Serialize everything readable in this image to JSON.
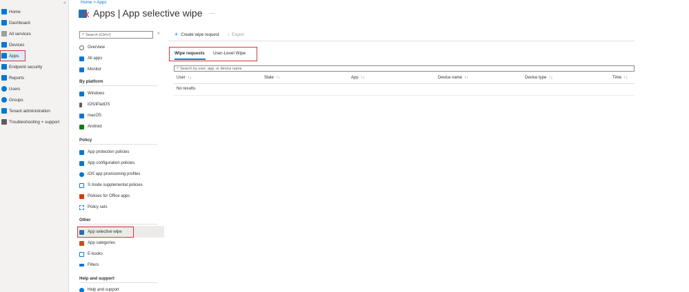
{
  "nav": {
    "collapse_glyph": "«",
    "items": [
      {
        "label": "Home",
        "icon": "home-icon",
        "color": "#0078d4"
      },
      {
        "label": "Dashboard",
        "icon": "dashboard-icon",
        "color": "#0078d4"
      },
      {
        "label": "All services",
        "icon": "list-icon",
        "color": "#605e5c"
      },
      {
        "label": "Devices",
        "icon": "devices-icon",
        "color": "#0078d4"
      },
      {
        "label": "Apps",
        "icon": "apps-icon",
        "color": "#0078d4"
      },
      {
        "label": "Endpoint security",
        "icon": "shield-icon",
        "color": "#0078d4"
      },
      {
        "label": "Reports",
        "icon": "reports-icon",
        "color": "#0078d4"
      },
      {
        "label": "Users",
        "icon": "user-icon",
        "color": "#0078d4"
      },
      {
        "label": "Groups",
        "icon": "groups-icon",
        "color": "#0078d4"
      },
      {
        "label": "Tenant administration",
        "icon": "tenant-icon",
        "color": "#0078d4"
      },
      {
        "label": "Troubleshooting + support",
        "icon": "wrench-icon",
        "color": "#605e5c"
      }
    ]
  },
  "breadcrumb": "Home  >  Apps",
  "page": {
    "title": "Apps | App selective wipe",
    "more": "···"
  },
  "menu": {
    "search_placeholder": "Search (Ctrl+/)",
    "collapse_glyph": "«",
    "top_items": [
      {
        "label": "Overview",
        "icon": "info-icon",
        "color": "#605e5c"
      },
      {
        "label": "All apps",
        "icon": "grid-icon",
        "color": "#0078d4"
      },
      {
        "label": "Monitor",
        "icon": "monitor-icon",
        "color": "#0078d4"
      }
    ],
    "sections": [
      {
        "heading": "By platform",
        "items": [
          {
            "label": "Windows",
            "icon": "windows-icon",
            "color": "#0078d4"
          },
          {
            "label": "iOS/iPadOS",
            "icon": "phone-icon",
            "color": "#605e5c"
          },
          {
            "label": "macOS",
            "icon": "mac-icon",
            "color": "#0078d4"
          },
          {
            "label": "Android",
            "icon": "android-icon",
            "color": "#107c10"
          }
        ]
      },
      {
        "heading": "Policy",
        "items": [
          {
            "label": "App protection policies",
            "icon": "protection-icon",
            "color": "#0078d4"
          },
          {
            "label": "App configuration policies",
            "icon": "config-icon",
            "color": "#0078d4"
          },
          {
            "label": "iOS app provisioning profiles",
            "icon": "provisioning-icon",
            "color": "#0078d4"
          },
          {
            "label": "S mode supplemental policies",
            "icon": "smode-icon",
            "color": "#0078d4"
          },
          {
            "label": "Policies for Office apps",
            "icon": "office-icon",
            "color": "#d83b01"
          },
          {
            "label": "Policy sets",
            "icon": "policy-sets-icon",
            "color": "#0078d4"
          }
        ]
      },
      {
        "heading": "Other",
        "items": [
          {
            "label": "App selective wipe",
            "icon": "wipe-icon",
            "color": "#2b6cb0"
          },
          {
            "label": "App categories",
            "icon": "categories-icon",
            "color": "#ca5010"
          },
          {
            "label": "E-books",
            "icon": "ebook-icon",
            "color": "#0078d4"
          },
          {
            "label": "Filters",
            "icon": "filter-icon",
            "color": "#0078d4"
          }
        ]
      },
      {
        "heading": "Help and support",
        "items": [
          {
            "label": "Help and support",
            "icon": "help-icon",
            "color": "#0078d4"
          }
        ]
      }
    ]
  },
  "toolbar": {
    "create_label": "Create wipe request",
    "export_label": "Export"
  },
  "tabs": [
    {
      "label": "Wipe requests",
      "active": true
    },
    {
      "label": "User-Level Wipe",
      "active": false
    }
  ],
  "grid": {
    "search_placeholder": "Search by user, app, or device name",
    "columns": [
      "User",
      "State",
      "App",
      "Device name",
      "Device type",
      "Time"
    ],
    "sort_glyph": "↑↓",
    "empty_text": "No results."
  }
}
